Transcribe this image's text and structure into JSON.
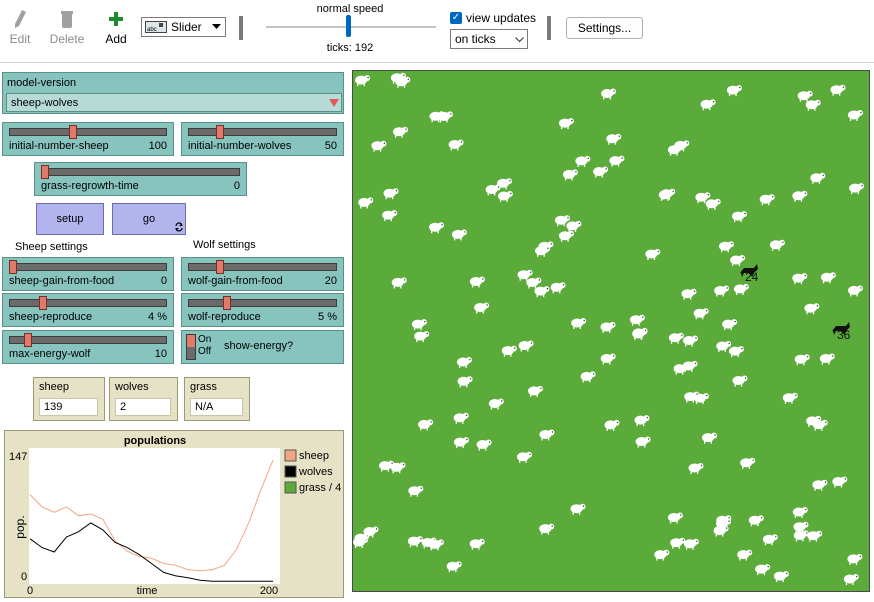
{
  "toolbar": {
    "edit_label": "Edit",
    "delete_label": "Delete",
    "add_label": "Add",
    "widget_type": "Slider",
    "speed_label": "normal speed",
    "ticks_label": "ticks: 192",
    "view_updates_label": "view updates",
    "update_mode": "on ticks",
    "settings_label": "Settings..."
  },
  "chooser": {
    "name": "model-version",
    "value": "sheep-wolves"
  },
  "sliders": {
    "initial_number_sheep": {
      "name": "initial-number-sheep",
      "value": "100",
      "fraction": 0.4
    },
    "initial_number_wolves": {
      "name": "initial-number-wolves",
      "value": "50",
      "fraction": 0.2
    },
    "grass_regrowth_time": {
      "name": "grass-regrowth-time",
      "value": "0",
      "fraction": 0.0
    },
    "sheep_gain_from_food": {
      "name": "sheep-gain-from-food",
      "value": "0",
      "fraction": 0.0
    },
    "wolf_gain_from_food": {
      "name": "wolf-gain-from-food",
      "value": "20",
      "fraction": 0.2
    },
    "sheep_reproduce": {
      "name": "sheep-reproduce",
      "value": "4 %",
      "fraction": 0.2
    },
    "wolf_reproduce": {
      "name": "wolf-reproduce",
      "value": "5 %",
      "fraction": 0.25
    },
    "max_energy_wolf": {
      "name": "max-energy-wolf",
      "value": "10",
      "fraction": 0.1
    }
  },
  "buttons": {
    "setup": "setup",
    "go": "go"
  },
  "sections": {
    "sheep": "Sheep settings",
    "wolf": "Wolf settings"
  },
  "switch": {
    "on": "On",
    "off": "Off",
    "name": "show-energy?"
  },
  "monitors": {
    "sheep": {
      "name": "sheep",
      "value": "139"
    },
    "wolves": {
      "name": "wolves",
      "value": "2"
    },
    "grass": {
      "name": "grass",
      "value": "N/A"
    }
  },
  "plot": {
    "title": "populations",
    "ylabel": "pop.",
    "xlabel": "time",
    "ymax_label": "147",
    "ymin_label": "0",
    "xmin_label": "0",
    "xmax_label": "200",
    "legend": [
      "sheep",
      "wolves",
      "grass / 4"
    ]
  },
  "world": {
    "wolf_labels": [
      "24",
      "36"
    ]
  },
  "colors": {
    "sheep_line": "#f4a582",
    "wolves_line": "#000000",
    "grass_line": "#5bab3b",
    "world_bg": "#5bab3b"
  },
  "chart_data": {
    "type": "line",
    "title": "populations",
    "xlabel": "time",
    "ylabel": "pop.",
    "xlim": [
      0,
      200
    ],
    "ylim": [
      0,
      147
    ],
    "legend_placement": "right",
    "series": [
      {
        "name": "sheep",
        "x": [
          0,
          10,
          20,
          30,
          40,
          50,
          60,
          70,
          80,
          90,
          100,
          110,
          120,
          130,
          140,
          150,
          160,
          170,
          180,
          190,
          200
        ],
        "values": [
          100,
          86,
          80,
          86,
          76,
          78,
          72,
          48,
          36,
          30,
          28,
          22,
          20,
          15,
          14,
          15,
          20,
          38,
          68,
          105,
          139
        ]
      },
      {
        "name": "wolves",
        "x": [
          0,
          10,
          20,
          30,
          40,
          50,
          60,
          70,
          80,
          90,
          100,
          110,
          120,
          130,
          140,
          150,
          160,
          170,
          180,
          190,
          200
        ],
        "values": [
          50,
          40,
          35,
          52,
          58,
          68,
          60,
          46,
          40,
          32,
          22,
          12,
          8,
          6,
          3,
          2,
          2,
          2,
          2,
          2,
          2
        ]
      },
      {
        "name": "grass / 4",
        "x": [],
        "values": []
      }
    ]
  }
}
